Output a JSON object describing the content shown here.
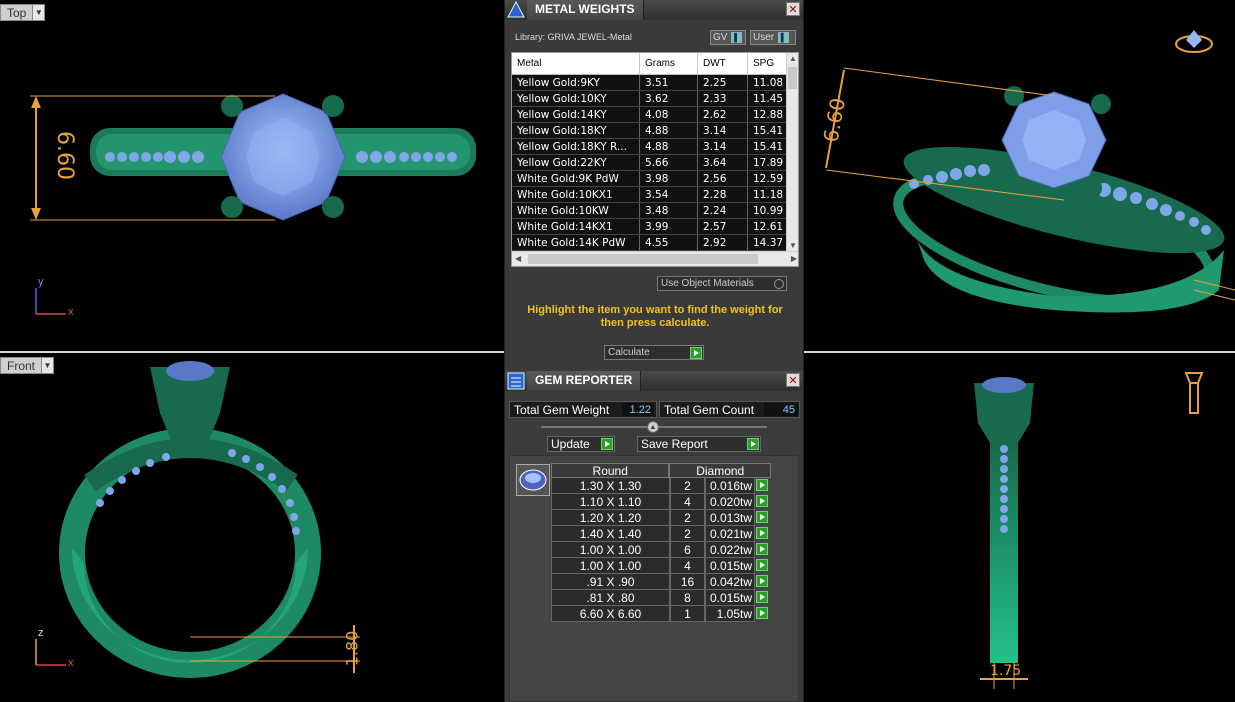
{
  "viewports": {
    "top": {
      "label": "Top",
      "dimension": "6.60",
      "axis_y": "y",
      "axis_x": "x"
    },
    "front": {
      "label": "Front",
      "dimension": "1.80",
      "axis_y": "z",
      "axis_x": "x"
    },
    "perspective": {
      "dimension": "6.60"
    },
    "right": {
      "dimension": "1.75"
    }
  },
  "metal_weights": {
    "title": "METAL WEIGHTS",
    "library": "Library: GRIVA JEWEL-Metal",
    "gv_label": "GV",
    "user_label": "User",
    "columns": [
      "Metal",
      "Grams",
      "DWT",
      "SPG"
    ],
    "rows": [
      {
        "metal": "Yellow Gold:9KY",
        "grams": "3.51",
        "dwt": "2.25",
        "spg": "11.08"
      },
      {
        "metal": "Yellow Gold:10KY",
        "grams": "3.62",
        "dwt": "2.33",
        "spg": "11.45"
      },
      {
        "metal": "Yellow Gold:14KY",
        "grams": "4.08",
        "dwt": "2.62",
        "spg": "12.88"
      },
      {
        "metal": "Yellow Gold:18KY",
        "grams": "4.88",
        "dwt": "3.14",
        "spg": "15.41"
      },
      {
        "metal": "Yellow Gold:18KY R...",
        "grams": "4.88",
        "dwt": "3.14",
        "spg": "15.41"
      },
      {
        "metal": "Yellow Gold:22KY",
        "grams": "5.66",
        "dwt": "3.64",
        "spg": "17.89"
      },
      {
        "metal": "White Gold:9K PdW",
        "grams": "3.98",
        "dwt": "2.56",
        "spg": "12.59"
      },
      {
        "metal": "White Gold:10KX1",
        "grams": "3.54",
        "dwt": "2.28",
        "spg": "11.18"
      },
      {
        "metal": "White Gold:10KW",
        "grams": "3.48",
        "dwt": "2.24",
        "spg": "10.99"
      },
      {
        "metal": "White Gold:14KX1",
        "grams": "3.99",
        "dwt": "2.57",
        "spg": "12.61"
      },
      {
        "metal": "White Gold:14K PdW",
        "grams": "4.55",
        "dwt": "2.92",
        "spg": "14.37"
      }
    ],
    "use_object_materials": "Use Object Materials",
    "hint": "Highlight the item you want to find the weight for then press calculate.",
    "calculate_label": "Calculate"
  },
  "gem_reporter": {
    "title": "GEM REPORTER",
    "total_weight_label": "Total Gem Weight",
    "total_weight_value": "1.22",
    "total_count_label": "Total Gem Count",
    "total_count_value": "45",
    "update_label": "Update",
    "save_label": "Save Report",
    "shape_header": "Round",
    "type_header": "Diamond",
    "rows": [
      {
        "size": "1.30 X 1.30",
        "count": "2",
        "weight": "0.016tw"
      },
      {
        "size": "1.10 X 1.10",
        "count": "4",
        "weight": "0.020tw"
      },
      {
        "size": "1.20 X 1.20",
        "count": "2",
        "weight": "0.013tw"
      },
      {
        "size": "1.40 X 1.40",
        "count": "2",
        "weight": "0.021tw"
      },
      {
        "size": "1.00 X 1.00",
        "count": "6",
        "weight": "0.022tw"
      },
      {
        "size": "1.00 X 1.00",
        "count": "4",
        "weight": "0.015tw"
      },
      {
        "size": ".91 X .90",
        "count": "16",
        "weight": "0.042tw"
      },
      {
        "size": ".81 X .80",
        "count": "8",
        "weight": "0.015tw"
      },
      {
        "size": "6.60 X 6.60",
        "count": "1",
        "weight": "1.05tw"
      }
    ]
  }
}
